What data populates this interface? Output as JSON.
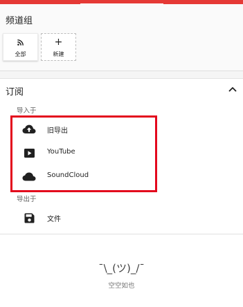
{
  "channel_groups": {
    "title": "频道组",
    "tiles": [
      {
        "label": "全部",
        "icon": "rss-icon"
      },
      {
        "label": "新建",
        "icon": "plus-icon",
        "glyph": "+"
      }
    ]
  },
  "subscriptions": {
    "title": "订阅",
    "collapse_icon": "chevron-up-icon",
    "import_label": "导入于",
    "import_items": [
      {
        "label": "旧导出",
        "icon": "cloud-upload-icon"
      },
      {
        "label": "YouTube",
        "icon": "youtube-play-icon"
      },
      {
        "label": "SoundCloud",
        "icon": "cloud-icon"
      }
    ],
    "export_label": "导出于",
    "export_items": [
      {
        "label": "文件",
        "icon": "save-icon"
      }
    ]
  },
  "empty_state": {
    "face": "¯\\_(ツ)_/¯",
    "text": "空空如也"
  },
  "colors": {
    "accent": "#e53935",
    "highlight": "#e3061c"
  }
}
